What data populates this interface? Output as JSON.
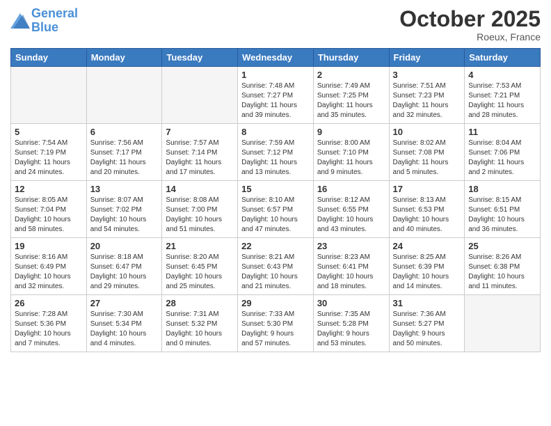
{
  "header": {
    "logo_line1": "General",
    "logo_line2": "Blue",
    "month": "October 2025",
    "location": "Roeux, France"
  },
  "days_of_week": [
    "Sunday",
    "Monday",
    "Tuesday",
    "Wednesday",
    "Thursday",
    "Friday",
    "Saturday"
  ],
  "weeks": [
    [
      {
        "num": "",
        "info": ""
      },
      {
        "num": "",
        "info": ""
      },
      {
        "num": "",
        "info": ""
      },
      {
        "num": "1",
        "info": "Sunrise: 7:48 AM\nSunset: 7:27 PM\nDaylight: 11 hours\nand 39 minutes."
      },
      {
        "num": "2",
        "info": "Sunrise: 7:49 AM\nSunset: 7:25 PM\nDaylight: 11 hours\nand 35 minutes."
      },
      {
        "num": "3",
        "info": "Sunrise: 7:51 AM\nSunset: 7:23 PM\nDaylight: 11 hours\nand 32 minutes."
      },
      {
        "num": "4",
        "info": "Sunrise: 7:53 AM\nSunset: 7:21 PM\nDaylight: 11 hours\nand 28 minutes."
      }
    ],
    [
      {
        "num": "5",
        "info": "Sunrise: 7:54 AM\nSunset: 7:19 PM\nDaylight: 11 hours\nand 24 minutes."
      },
      {
        "num": "6",
        "info": "Sunrise: 7:56 AM\nSunset: 7:17 PM\nDaylight: 11 hours\nand 20 minutes."
      },
      {
        "num": "7",
        "info": "Sunrise: 7:57 AM\nSunset: 7:14 PM\nDaylight: 11 hours\nand 17 minutes."
      },
      {
        "num": "8",
        "info": "Sunrise: 7:59 AM\nSunset: 7:12 PM\nDaylight: 11 hours\nand 13 minutes."
      },
      {
        "num": "9",
        "info": "Sunrise: 8:00 AM\nSunset: 7:10 PM\nDaylight: 11 hours\nand 9 minutes."
      },
      {
        "num": "10",
        "info": "Sunrise: 8:02 AM\nSunset: 7:08 PM\nDaylight: 11 hours\nand 5 minutes."
      },
      {
        "num": "11",
        "info": "Sunrise: 8:04 AM\nSunset: 7:06 PM\nDaylight: 11 hours\nand 2 minutes."
      }
    ],
    [
      {
        "num": "12",
        "info": "Sunrise: 8:05 AM\nSunset: 7:04 PM\nDaylight: 10 hours\nand 58 minutes."
      },
      {
        "num": "13",
        "info": "Sunrise: 8:07 AM\nSunset: 7:02 PM\nDaylight: 10 hours\nand 54 minutes."
      },
      {
        "num": "14",
        "info": "Sunrise: 8:08 AM\nSunset: 7:00 PM\nDaylight: 10 hours\nand 51 minutes."
      },
      {
        "num": "15",
        "info": "Sunrise: 8:10 AM\nSunset: 6:57 PM\nDaylight: 10 hours\nand 47 minutes."
      },
      {
        "num": "16",
        "info": "Sunrise: 8:12 AM\nSunset: 6:55 PM\nDaylight: 10 hours\nand 43 minutes."
      },
      {
        "num": "17",
        "info": "Sunrise: 8:13 AM\nSunset: 6:53 PM\nDaylight: 10 hours\nand 40 minutes."
      },
      {
        "num": "18",
        "info": "Sunrise: 8:15 AM\nSunset: 6:51 PM\nDaylight: 10 hours\nand 36 minutes."
      }
    ],
    [
      {
        "num": "19",
        "info": "Sunrise: 8:16 AM\nSunset: 6:49 PM\nDaylight: 10 hours\nand 32 minutes."
      },
      {
        "num": "20",
        "info": "Sunrise: 8:18 AM\nSunset: 6:47 PM\nDaylight: 10 hours\nand 29 minutes."
      },
      {
        "num": "21",
        "info": "Sunrise: 8:20 AM\nSunset: 6:45 PM\nDaylight: 10 hours\nand 25 minutes."
      },
      {
        "num": "22",
        "info": "Sunrise: 8:21 AM\nSunset: 6:43 PM\nDaylight: 10 hours\nand 21 minutes."
      },
      {
        "num": "23",
        "info": "Sunrise: 8:23 AM\nSunset: 6:41 PM\nDaylight: 10 hours\nand 18 minutes."
      },
      {
        "num": "24",
        "info": "Sunrise: 8:25 AM\nSunset: 6:39 PM\nDaylight: 10 hours\nand 14 minutes."
      },
      {
        "num": "25",
        "info": "Sunrise: 8:26 AM\nSunset: 6:38 PM\nDaylight: 10 hours\nand 11 minutes."
      }
    ],
    [
      {
        "num": "26",
        "info": "Sunrise: 7:28 AM\nSunset: 5:36 PM\nDaylight: 10 hours\nand 7 minutes."
      },
      {
        "num": "27",
        "info": "Sunrise: 7:30 AM\nSunset: 5:34 PM\nDaylight: 10 hours\nand 4 minutes."
      },
      {
        "num": "28",
        "info": "Sunrise: 7:31 AM\nSunset: 5:32 PM\nDaylight: 10 hours\nand 0 minutes."
      },
      {
        "num": "29",
        "info": "Sunrise: 7:33 AM\nSunset: 5:30 PM\nDaylight: 9 hours\nand 57 minutes."
      },
      {
        "num": "30",
        "info": "Sunrise: 7:35 AM\nSunset: 5:28 PM\nDaylight: 9 hours\nand 53 minutes."
      },
      {
        "num": "31",
        "info": "Sunrise: 7:36 AM\nSunset: 5:27 PM\nDaylight: 9 hours\nand 50 minutes."
      },
      {
        "num": "",
        "info": ""
      }
    ]
  ]
}
